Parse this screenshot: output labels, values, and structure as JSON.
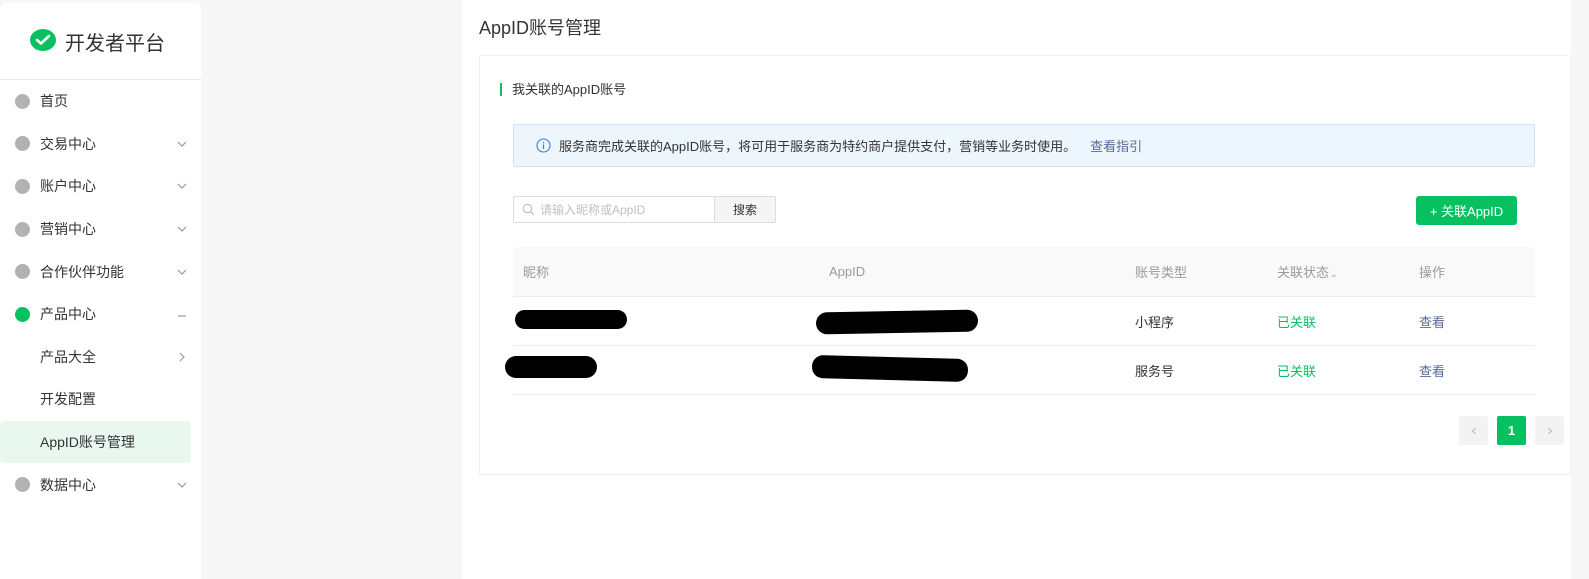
{
  "brand": {
    "title": "开发者平台"
  },
  "sidebar": {
    "items": [
      {
        "label": "首页",
        "has_chevron": false
      },
      {
        "label": "交易中心",
        "has_chevron": true
      },
      {
        "label": "账户中心",
        "has_chevron": true
      },
      {
        "label": "营销中心",
        "has_chevron": true
      },
      {
        "label": "合作伙伴功能",
        "has_chevron": true
      },
      {
        "label": "产品中心",
        "expanded": true
      },
      {
        "label": "产品大全"
      },
      {
        "label": "开发配置"
      },
      {
        "label": "AppID账号管理",
        "selected": true
      },
      {
        "label": "数据中心",
        "has_chevron": true
      }
    ]
  },
  "main": {
    "title": "AppID账号管理",
    "section_title": "我关联的AppID账号",
    "notice": {
      "text": "服务商完成关联的AppID账号，将可用于服务商为特约商户提供支付，营销等业务时使用。",
      "link": "查看指引"
    },
    "search": {
      "placeholder": "请输入昵称或AppID",
      "button": "搜索"
    },
    "link_button": "+ 关联AppID",
    "table": {
      "headers": [
        "昵称",
        "AppID",
        "账号类型",
        "关联状态",
        "操作"
      ],
      "rows": [
        {
          "type": "小程序",
          "status": "已关联",
          "action": "查看"
        },
        {
          "type": "服务号",
          "status": "已关联",
          "action": "查看"
        }
      ]
    },
    "pagination": {
      "current": "1"
    }
  },
  "colors": {
    "accent": "#07c160",
    "link": "#576b95"
  }
}
